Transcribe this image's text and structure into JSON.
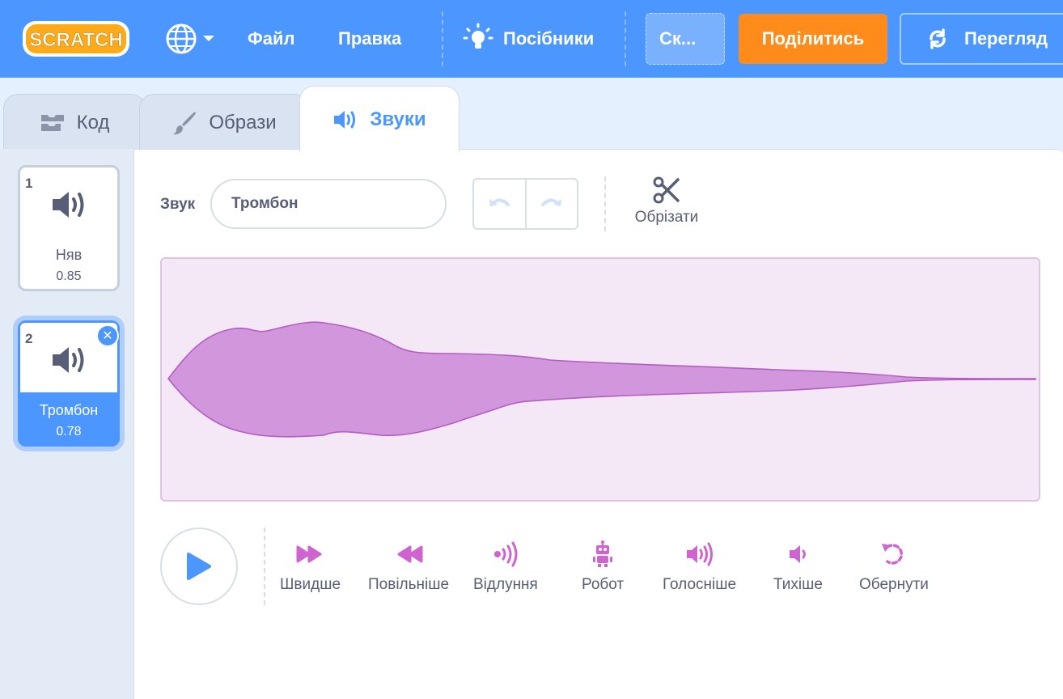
{
  "menubar": {
    "logo_text": "SCRATCH",
    "file": "Файл",
    "edit": "Правка",
    "tutorials": "Посібники",
    "project_title": "Ск...",
    "share": "Поділитись",
    "see_project": "Перегляд"
  },
  "tabs": {
    "code": "Код",
    "costumes": "Образи",
    "sounds": "Звуки"
  },
  "sounds": [
    {
      "index": "1",
      "name": "Няв",
      "duration": "0.85"
    },
    {
      "index": "2",
      "name": "Тромбон",
      "duration": "0.78"
    }
  ],
  "editor": {
    "sound_label": "Звук",
    "sound_name": "Тромбон",
    "trim": "Обрізати"
  },
  "effects": {
    "faster": "Швидше",
    "slower": "Повільніше",
    "echo": "Відлуння",
    "robot": "Робот",
    "louder": "Голосніше",
    "softer": "Тихіше",
    "reverse": "Обернути"
  },
  "colors": {
    "brand": "#4c97ff",
    "share": "#ff8c1a",
    "effect": "#cf63cf",
    "waveform_fill": "#d296dc",
    "waveform_bg": "#f4e8f7"
  },
  "icons": {
    "globe": "globe-icon",
    "tutorials": "lightbulb-icon",
    "see_project": "arrows-circle-icon",
    "code": "code-blocks-icon",
    "costumes": "paintbrush-icon",
    "sounds": "speaker-icon",
    "undo": "undo-icon",
    "redo": "redo-icon",
    "trim": "scissors-icon",
    "play": "play-icon"
  }
}
